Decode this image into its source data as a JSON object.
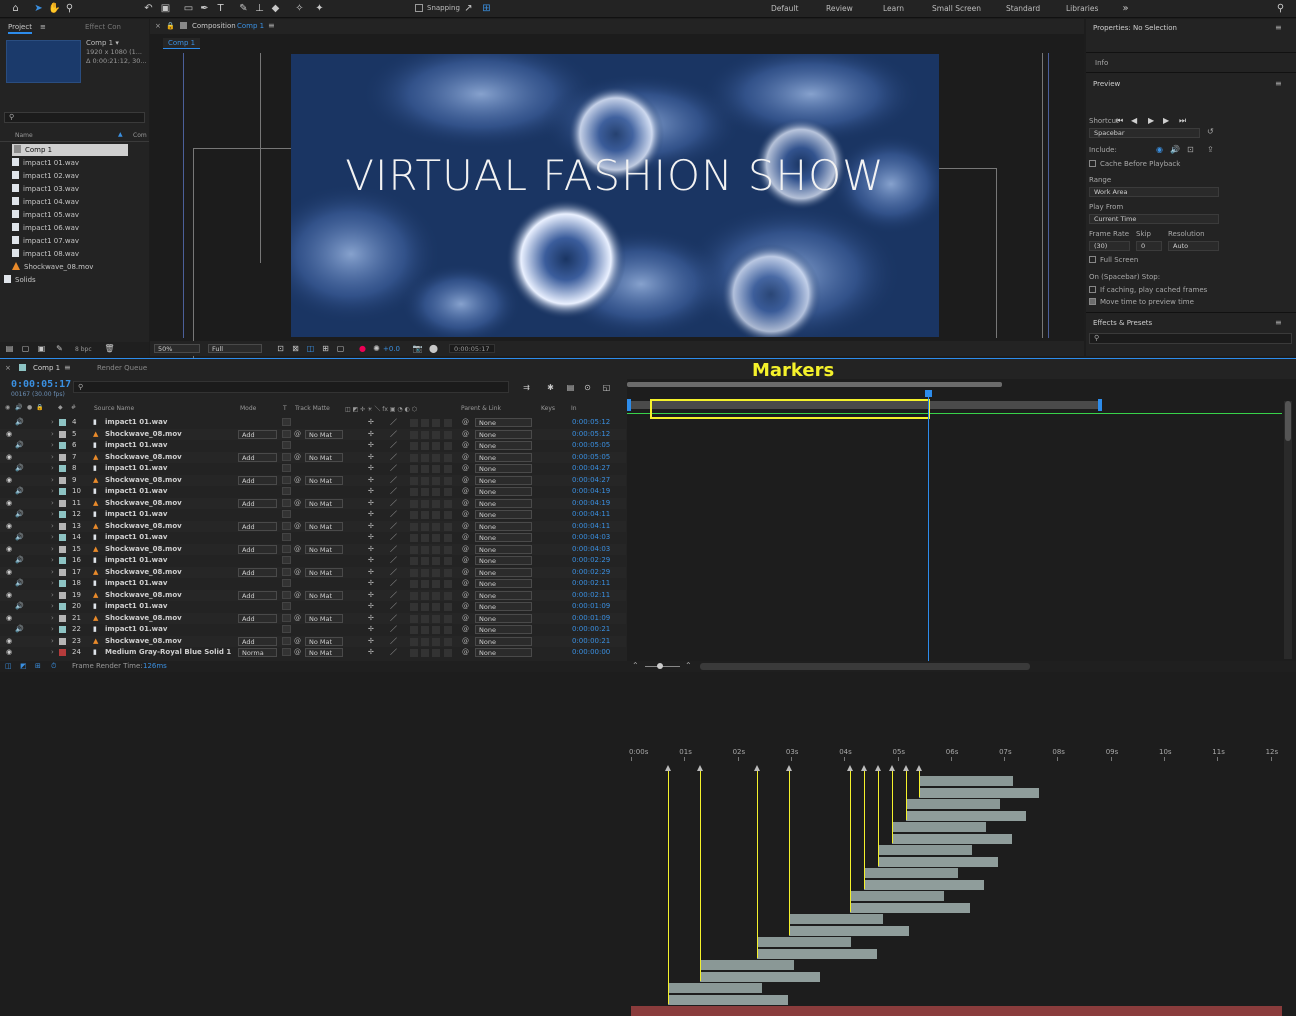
{
  "toolbar": {
    "snapping_label": "Snapping",
    "workspaces": [
      "Default",
      "Review",
      "Learn",
      "Small Screen",
      "Standard",
      "Libraries"
    ]
  },
  "project": {
    "tab_project": "Project",
    "tab_effect": "Effect Con",
    "comp_name": "Comp 1 ▾",
    "comp_size": "1920 x 1080 (1...",
    "comp_duration": "Δ 0:00:21:12, 30...",
    "search_placeholder": "",
    "col_name": "Name",
    "col_comment": "Com",
    "items": [
      {
        "name": "Comp 1",
        "type": "comp"
      },
      {
        "name": "impact1 01.wav",
        "type": "wav"
      },
      {
        "name": "impact1 02.wav",
        "type": "wav"
      },
      {
        "name": "impact1 03.wav",
        "type": "wav"
      },
      {
        "name": "impact1 04.wav",
        "type": "wav"
      },
      {
        "name": "impact1 05.wav",
        "type": "wav"
      },
      {
        "name": "impact1 06.wav",
        "type": "wav"
      },
      {
        "name": "impact1 07.wav",
        "type": "wav"
      },
      {
        "name": "impact1 08.wav",
        "type": "wav"
      },
      {
        "name": "Shockwave_08.mov",
        "type": "mov"
      },
      {
        "name": "Solids",
        "type": "folder"
      }
    ],
    "bpc": "8 bpc"
  },
  "composition": {
    "panel_title": "Composition",
    "comp_link": "Comp 1",
    "tab_label": "Comp 1",
    "title_text": "VIRTUAL FASHION SHOW",
    "zoom": "50%",
    "resolution": "Full",
    "exposure": "+0.0",
    "timecode": "0:00:05:17"
  },
  "properties": {
    "title": "Properties: No Selection",
    "info": "Info",
    "preview": "Preview",
    "shortcut_label": "Shortcut",
    "shortcut_value": "Spacebar",
    "include_label": "Include:",
    "cache_label": "Cache Before Playback",
    "range_label": "Range",
    "range_value": "Work Area",
    "playfrom_label": "Play From",
    "playfrom_value": "Current Time",
    "framerate_label": "Frame Rate",
    "skip_label": "Skip",
    "resolution_label": "Resolution",
    "framerate_value": "(30)",
    "skip_value": "0",
    "resolution_value": "Auto",
    "fullscreen_label": "Full Screen",
    "onstop_label": "On (Spacebar) Stop:",
    "ifcaching_label": "If caching, play cached frames",
    "movetime_label": "Move time to preview time",
    "effects_label": "Effects & Presets"
  },
  "timeline": {
    "tab_comp": "Comp 1",
    "tab_render": "Render Queue",
    "current_time": "0:00:05:17",
    "frame_info": "00167 (30.00 fps)",
    "col_source": "Source Name",
    "col_mode": "Mode",
    "col_t": "T",
    "col_trackmatte": "Track Matte",
    "col_parent": "Parent & Link",
    "col_keys": "Keys",
    "col_in": "In",
    "annotation": "Markers",
    "render_time_label": "Frame Render Time:",
    "render_time_value": "126ms",
    "ruler": [
      "0:00s",
      "01s",
      "02s",
      "03s",
      "04s",
      "05s",
      "06s",
      "07s",
      "08s",
      "09s",
      "10s",
      "11s",
      "12s"
    ],
    "layers": [
      {
        "num": "4",
        "name": "impact1 01.wav",
        "type": "wav",
        "mode": "",
        "tm": "",
        "parent": "None",
        "in": "0:00:05:12"
      },
      {
        "num": "5",
        "name": "Shockwave_08.mov",
        "type": "mov",
        "mode": "Add",
        "tm": "No Mat",
        "parent": "None",
        "in": "0:00:05:12"
      },
      {
        "num": "6",
        "name": "impact1 01.wav",
        "type": "wav",
        "mode": "",
        "tm": "",
        "parent": "None",
        "in": "0:00:05:05"
      },
      {
        "num": "7",
        "name": "Shockwave_08.mov",
        "type": "mov",
        "mode": "Add",
        "tm": "No Mat",
        "parent": "None",
        "in": "0:00:05:05"
      },
      {
        "num": "8",
        "name": "impact1 01.wav",
        "type": "wav",
        "mode": "",
        "tm": "",
        "parent": "None",
        "in": "0:00:04:27"
      },
      {
        "num": "9",
        "name": "Shockwave_08.mov",
        "type": "mov",
        "mode": "Add",
        "tm": "No Mat",
        "parent": "None",
        "in": "0:00:04:27"
      },
      {
        "num": "10",
        "name": "impact1 01.wav",
        "type": "wav",
        "mode": "",
        "tm": "",
        "parent": "None",
        "in": "0:00:04:19"
      },
      {
        "num": "11",
        "name": "Shockwave_08.mov",
        "type": "mov",
        "mode": "Add",
        "tm": "No Mat",
        "parent": "None",
        "in": "0:00:04:19"
      },
      {
        "num": "12",
        "name": "impact1 01.wav",
        "type": "wav",
        "mode": "",
        "tm": "",
        "parent": "None",
        "in": "0:00:04:11"
      },
      {
        "num": "13",
        "name": "Shockwave_08.mov",
        "type": "mov",
        "mode": "Add",
        "tm": "No Mat",
        "parent": "None",
        "in": "0:00:04:11"
      },
      {
        "num": "14",
        "name": "impact1 01.wav",
        "type": "wav",
        "mode": "",
        "tm": "",
        "parent": "None",
        "in": "0:00:04:03"
      },
      {
        "num": "15",
        "name": "Shockwave_08.mov",
        "type": "mov",
        "mode": "Add",
        "tm": "No Mat",
        "parent": "None",
        "in": "0:00:04:03"
      },
      {
        "num": "16",
        "name": "impact1 01.wav",
        "type": "wav",
        "mode": "",
        "tm": "",
        "parent": "None",
        "in": "0:00:02:29"
      },
      {
        "num": "17",
        "name": "Shockwave_08.mov",
        "type": "mov",
        "mode": "Add",
        "tm": "No Mat",
        "parent": "None",
        "in": "0:00:02:29"
      },
      {
        "num": "18",
        "name": "impact1 01.wav",
        "type": "wav",
        "mode": "",
        "tm": "",
        "parent": "None",
        "in": "0:00:02:11"
      },
      {
        "num": "19",
        "name": "Shockwave_08.mov",
        "type": "mov",
        "mode": "Add",
        "tm": "No Mat",
        "parent": "None",
        "in": "0:00:02:11"
      },
      {
        "num": "20",
        "name": "impact1 01.wav",
        "type": "wav",
        "mode": "",
        "tm": "",
        "parent": "None",
        "in": "0:00:01:09"
      },
      {
        "num": "21",
        "name": "Shockwave_08.mov",
        "type": "mov",
        "mode": "Add",
        "tm": "No Mat",
        "parent": "None",
        "in": "0:00:01:09"
      },
      {
        "num": "22",
        "name": "impact1 01.wav",
        "type": "wav",
        "mode": "",
        "tm": "",
        "parent": "None",
        "in": "0:00:00:21"
      },
      {
        "num": "23",
        "name": "Shockwave_08.mov",
        "type": "mov",
        "mode": "Add",
        "tm": "No Mat",
        "parent": "None",
        "in": "0:00:00:21"
      },
      {
        "num": "24",
        "name": "Medium Gray-Royal Blue Solid 1",
        "type": "solid",
        "mode": "Norma",
        "tm": "No Mat",
        "parent": "None",
        "in": "0:00:00:00"
      }
    ]
  },
  "colors": {
    "accent_blue": "#2d8ceb",
    "marker_yellow": "#f4f12b",
    "comp_bg": "#1a3563",
    "time_blue": "#3a8fe0"
  }
}
